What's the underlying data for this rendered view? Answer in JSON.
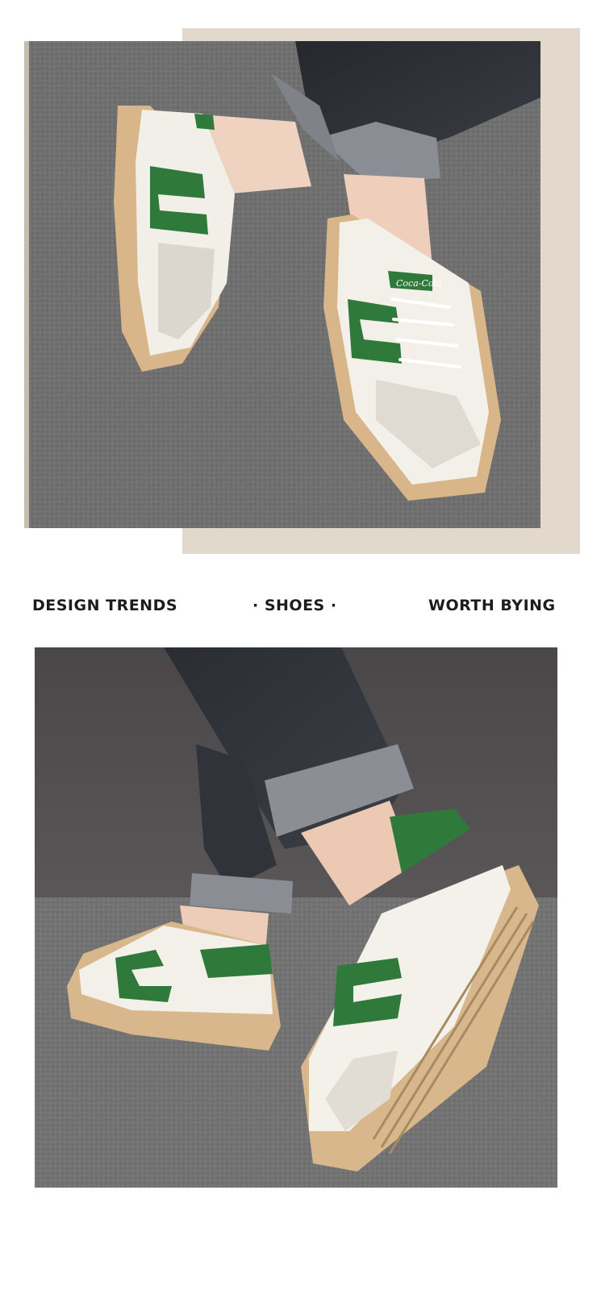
{
  "tagline": {
    "left": "DESIGN TRENDS",
    "center": "· SHOES ·",
    "right": "WORTH BYING"
  },
  "photos": {
    "top": {
      "subject": "two white sneakers with green side stripes and gum soles, worn with rolled dark jeans, on grey carpet",
      "tongue_text": "Coca-Cola"
    },
    "bottom": {
      "subject": "side and rear view of white sneakers with green heel tab and gum sole, worn with rolled dark jeans"
    }
  },
  "colors": {
    "frame_beige": "#e2d9cc",
    "carpet_grey": "#6e6e6e",
    "sneaker_white": "#f3f0ea",
    "stripe_green": "#2f7a3a",
    "gum_sole": "#d8b78c",
    "denim_dark": "#2c2f35"
  }
}
